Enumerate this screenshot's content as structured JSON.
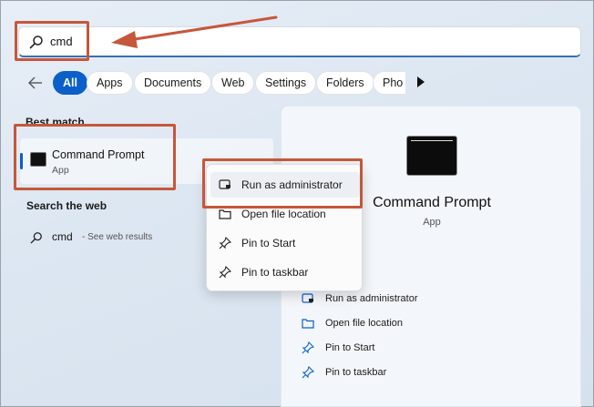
{
  "search": {
    "value": "cmd"
  },
  "filters": [
    "All",
    "Apps",
    "Documents",
    "Web",
    "Settings",
    "Folders",
    "Pho"
  ],
  "best_match": {
    "title": "Best match",
    "name": "Command Prompt",
    "type": "App"
  },
  "web_search": {
    "title": "Search the web",
    "query": "cmd",
    "hint": "- See web results"
  },
  "context_menu": {
    "items": [
      "Run as administrator",
      "Open file location",
      "Pin to Start",
      "Pin to taskbar"
    ]
  },
  "details": {
    "name": "Command Prompt",
    "type": "App",
    "actions": [
      "Run as administrator",
      "Open file location",
      "Pin to Start",
      "Pin to taskbar"
    ]
  },
  "icons": {
    "search": "search-icon",
    "back": "back-arrow-icon",
    "more": "play-right-icon",
    "admin": "shield-admin-icon",
    "folder": "folder-open-icon",
    "pin": "pin-icon",
    "cmd": "command-prompt-icon"
  },
  "colors": {
    "accent": "#0a5fc9",
    "annotation": "#c6573a"
  }
}
